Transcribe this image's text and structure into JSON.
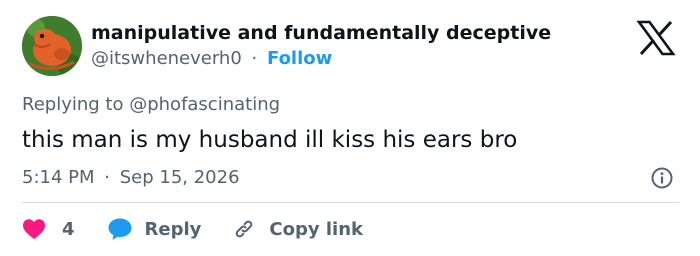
{
  "author": {
    "display_name": "manipulative and fundamentally deceptive",
    "handle": "@itswheneverh0",
    "separator": "·",
    "follow_label": "Follow",
    "avatar_bg": "#3f7d2c",
    "avatar_figure": "#e2622a"
  },
  "reply_context": {
    "prefix": "Replying to",
    "mention": "@phofascinating"
  },
  "tweet": {
    "text": "this man is my husband ill kiss his ears bro",
    "time": "5:14 PM",
    "separator": "·",
    "date": "Sep 15, 2026"
  },
  "actions": {
    "like_count": "4",
    "reply_label": "Reply",
    "copy_link_label": "Copy link"
  },
  "colors": {
    "like": "#f91880",
    "reply": "#1d9bf0",
    "link": "#1d9bf0",
    "muted": "#536471",
    "text": "#0f1419",
    "divider": "#cfd9de"
  },
  "icons": {
    "brand": "x-logo-icon",
    "info": "info-icon",
    "like": "heart-icon",
    "reply": "speech-bubble-icon",
    "copy": "link-icon"
  }
}
